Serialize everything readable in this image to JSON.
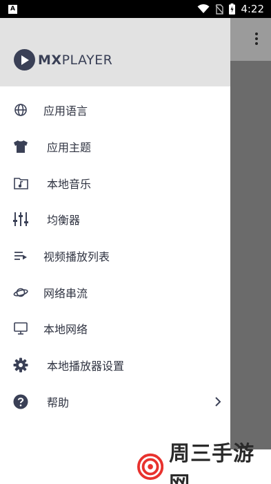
{
  "status_bar": {
    "app_icon_letter": "A",
    "time": "4:22"
  },
  "drawer": {
    "logo": {
      "bold": "MX",
      "rest": "PLAYER"
    },
    "items": [
      {
        "label": "应用语言",
        "icon": "globe-icon"
      },
      {
        "label": "应用主题",
        "icon": "tshirt-icon"
      },
      {
        "label": "本地音乐",
        "icon": "music-folder-icon"
      },
      {
        "label": "均衡器",
        "icon": "equalizer-icon"
      },
      {
        "label": "视频播放列表",
        "icon": "playlist-icon"
      },
      {
        "label": "网络串流",
        "icon": "planet-icon"
      },
      {
        "label": "本地网络",
        "icon": "monitor-icon"
      },
      {
        "label": "本地播放器设置",
        "icon": "gear-icon"
      },
      {
        "label": "帮助",
        "icon": "help-icon"
      }
    ]
  },
  "watermark": {
    "text": "周三手游网"
  },
  "colors": {
    "drawer_header_bg": "#e2e2e2",
    "icon_color": "#3a4056",
    "scrim": "#6e6e6e",
    "watermark_red": "#e8322e"
  }
}
